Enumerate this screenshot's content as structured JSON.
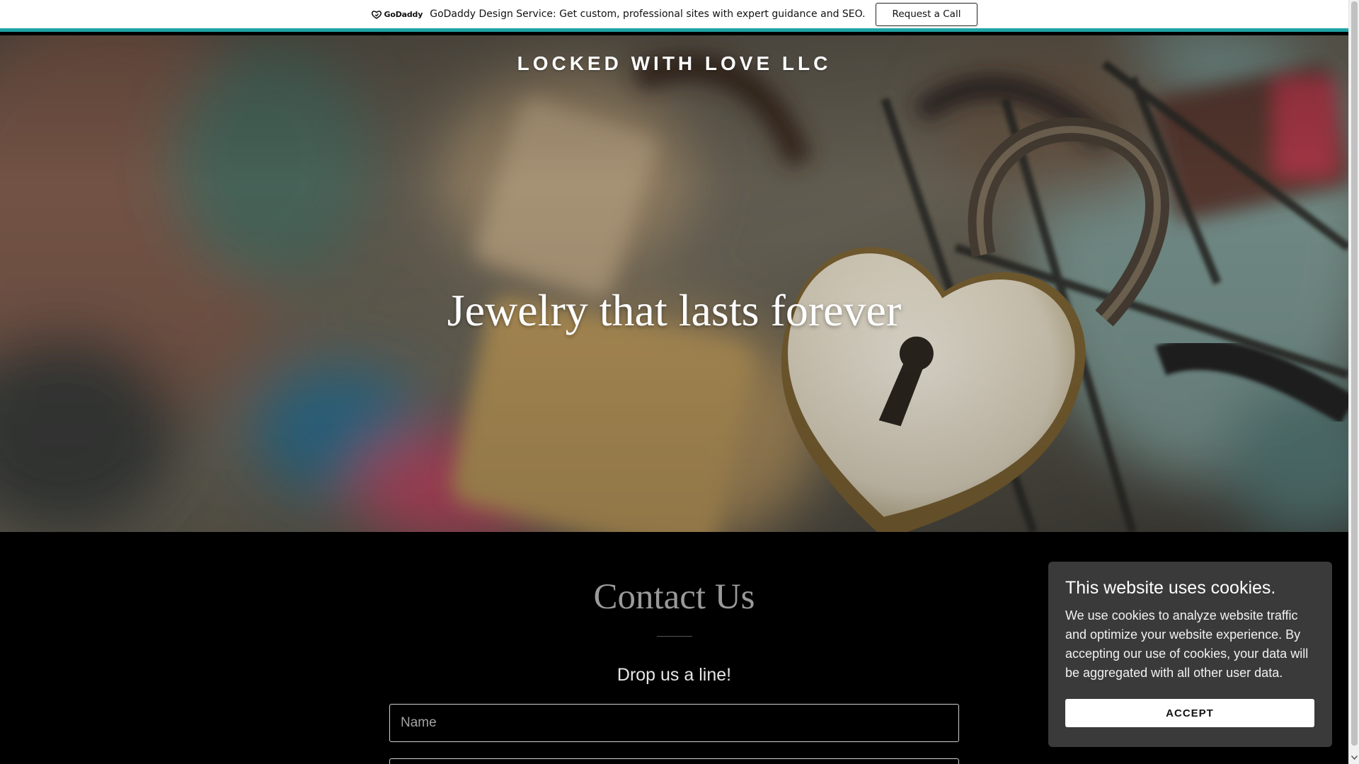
{
  "promo_bar": {
    "logo_text": "GoDaddy",
    "message": "GoDaddy Design Service: Get custom, professional sites with expert guidance and SEO.",
    "cta_label": "Request a Call",
    "accent_color": "#1fa3a6"
  },
  "hero": {
    "brand_name": "LOCKED WITH LOVE LLC",
    "tagline": "Jewelry that lasts forever",
    "background_image": "padlocks-on-fence-heart-lock"
  },
  "contact": {
    "title": "Contact Us",
    "subtitle": "Drop us a line!",
    "name_placeholder": "Name"
  },
  "cookie_banner": {
    "title": "This website uses cookies.",
    "body": "We use cookies to analyze website traffic and optimize your website experience. By accepting our use of cookies, your data will be aggregated with all other user data.",
    "accept_label": "ACCEPT"
  },
  "icons": {
    "promo_logo_icon": "godaddy-logo-icon",
    "scroll_down_icon": "chevron-down-icon"
  }
}
